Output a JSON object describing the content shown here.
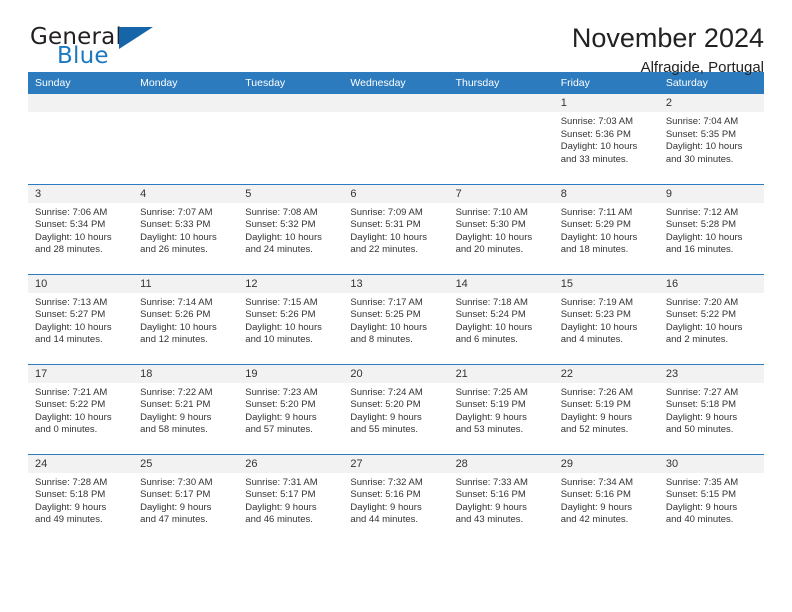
{
  "brand": {
    "name_part1": "General",
    "name_part2": "Blue",
    "flag_icon": "triangle-flag-icon"
  },
  "header": {
    "title": "November 2024",
    "subtitle": "Alfragide, Portugal"
  },
  "colors": {
    "header_blue": "#2c7bbf",
    "brand_blue": "#1c79c0",
    "daynum_bg": "#f2f2f2"
  },
  "weekdays": [
    "Sunday",
    "Monday",
    "Tuesday",
    "Wednesday",
    "Thursday",
    "Friday",
    "Saturday"
  ],
  "weeks": [
    [
      {
        "empty": true
      },
      {
        "empty": true
      },
      {
        "empty": true
      },
      {
        "empty": true
      },
      {
        "empty": true
      },
      {
        "day": "1",
        "sunrise": "Sunrise: 7:03 AM",
        "sunset": "Sunset: 5:36 PM",
        "daylight1": "Daylight: 10 hours",
        "daylight2": "and 33 minutes."
      },
      {
        "day": "2",
        "sunrise": "Sunrise: 7:04 AM",
        "sunset": "Sunset: 5:35 PM",
        "daylight1": "Daylight: 10 hours",
        "daylight2": "and 30 minutes."
      }
    ],
    [
      {
        "day": "3",
        "sunrise": "Sunrise: 7:06 AM",
        "sunset": "Sunset: 5:34 PM",
        "daylight1": "Daylight: 10 hours",
        "daylight2": "and 28 minutes."
      },
      {
        "day": "4",
        "sunrise": "Sunrise: 7:07 AM",
        "sunset": "Sunset: 5:33 PM",
        "daylight1": "Daylight: 10 hours",
        "daylight2": "and 26 minutes."
      },
      {
        "day": "5",
        "sunrise": "Sunrise: 7:08 AM",
        "sunset": "Sunset: 5:32 PM",
        "daylight1": "Daylight: 10 hours",
        "daylight2": "and 24 minutes."
      },
      {
        "day": "6",
        "sunrise": "Sunrise: 7:09 AM",
        "sunset": "Sunset: 5:31 PM",
        "daylight1": "Daylight: 10 hours",
        "daylight2": "and 22 minutes."
      },
      {
        "day": "7",
        "sunrise": "Sunrise: 7:10 AM",
        "sunset": "Sunset: 5:30 PM",
        "daylight1": "Daylight: 10 hours",
        "daylight2": "and 20 minutes."
      },
      {
        "day": "8",
        "sunrise": "Sunrise: 7:11 AM",
        "sunset": "Sunset: 5:29 PM",
        "daylight1": "Daylight: 10 hours",
        "daylight2": "and 18 minutes."
      },
      {
        "day": "9",
        "sunrise": "Sunrise: 7:12 AM",
        "sunset": "Sunset: 5:28 PM",
        "daylight1": "Daylight: 10 hours",
        "daylight2": "and 16 minutes."
      }
    ],
    [
      {
        "day": "10",
        "sunrise": "Sunrise: 7:13 AM",
        "sunset": "Sunset: 5:27 PM",
        "daylight1": "Daylight: 10 hours",
        "daylight2": "and 14 minutes."
      },
      {
        "day": "11",
        "sunrise": "Sunrise: 7:14 AM",
        "sunset": "Sunset: 5:26 PM",
        "daylight1": "Daylight: 10 hours",
        "daylight2": "and 12 minutes."
      },
      {
        "day": "12",
        "sunrise": "Sunrise: 7:15 AM",
        "sunset": "Sunset: 5:26 PM",
        "daylight1": "Daylight: 10 hours",
        "daylight2": "and 10 minutes."
      },
      {
        "day": "13",
        "sunrise": "Sunrise: 7:17 AM",
        "sunset": "Sunset: 5:25 PM",
        "daylight1": "Daylight: 10 hours",
        "daylight2": "and 8 minutes."
      },
      {
        "day": "14",
        "sunrise": "Sunrise: 7:18 AM",
        "sunset": "Sunset: 5:24 PM",
        "daylight1": "Daylight: 10 hours",
        "daylight2": "and 6 minutes."
      },
      {
        "day": "15",
        "sunrise": "Sunrise: 7:19 AM",
        "sunset": "Sunset: 5:23 PM",
        "daylight1": "Daylight: 10 hours",
        "daylight2": "and 4 minutes."
      },
      {
        "day": "16",
        "sunrise": "Sunrise: 7:20 AM",
        "sunset": "Sunset: 5:22 PM",
        "daylight1": "Daylight: 10 hours",
        "daylight2": "and 2 minutes."
      }
    ],
    [
      {
        "day": "17",
        "sunrise": "Sunrise: 7:21 AM",
        "sunset": "Sunset: 5:22 PM",
        "daylight1": "Daylight: 10 hours",
        "daylight2": "and 0 minutes."
      },
      {
        "day": "18",
        "sunrise": "Sunrise: 7:22 AM",
        "sunset": "Sunset: 5:21 PM",
        "daylight1": "Daylight: 9 hours",
        "daylight2": "and 58 minutes."
      },
      {
        "day": "19",
        "sunrise": "Sunrise: 7:23 AM",
        "sunset": "Sunset: 5:20 PM",
        "daylight1": "Daylight: 9 hours",
        "daylight2": "and 57 minutes."
      },
      {
        "day": "20",
        "sunrise": "Sunrise: 7:24 AM",
        "sunset": "Sunset: 5:20 PM",
        "daylight1": "Daylight: 9 hours",
        "daylight2": "and 55 minutes."
      },
      {
        "day": "21",
        "sunrise": "Sunrise: 7:25 AM",
        "sunset": "Sunset: 5:19 PM",
        "daylight1": "Daylight: 9 hours",
        "daylight2": "and 53 minutes."
      },
      {
        "day": "22",
        "sunrise": "Sunrise: 7:26 AM",
        "sunset": "Sunset: 5:19 PM",
        "daylight1": "Daylight: 9 hours",
        "daylight2": "and 52 minutes."
      },
      {
        "day": "23",
        "sunrise": "Sunrise: 7:27 AM",
        "sunset": "Sunset: 5:18 PM",
        "daylight1": "Daylight: 9 hours",
        "daylight2": "and 50 minutes."
      }
    ],
    [
      {
        "day": "24",
        "sunrise": "Sunrise: 7:28 AM",
        "sunset": "Sunset: 5:18 PM",
        "daylight1": "Daylight: 9 hours",
        "daylight2": "and 49 minutes."
      },
      {
        "day": "25",
        "sunrise": "Sunrise: 7:30 AM",
        "sunset": "Sunset: 5:17 PM",
        "daylight1": "Daylight: 9 hours",
        "daylight2": "and 47 minutes."
      },
      {
        "day": "26",
        "sunrise": "Sunrise: 7:31 AM",
        "sunset": "Sunset: 5:17 PM",
        "daylight1": "Daylight: 9 hours",
        "daylight2": "and 46 minutes."
      },
      {
        "day": "27",
        "sunrise": "Sunrise: 7:32 AM",
        "sunset": "Sunset: 5:16 PM",
        "daylight1": "Daylight: 9 hours",
        "daylight2": "and 44 minutes."
      },
      {
        "day": "28",
        "sunrise": "Sunrise: 7:33 AM",
        "sunset": "Sunset: 5:16 PM",
        "daylight1": "Daylight: 9 hours",
        "daylight2": "and 43 minutes."
      },
      {
        "day": "29",
        "sunrise": "Sunrise: 7:34 AM",
        "sunset": "Sunset: 5:16 PM",
        "daylight1": "Daylight: 9 hours",
        "daylight2": "and 42 minutes."
      },
      {
        "day": "30",
        "sunrise": "Sunrise: 7:35 AM",
        "sunset": "Sunset: 5:15 PM",
        "daylight1": "Daylight: 9 hours",
        "daylight2": "and 40 minutes."
      }
    ]
  ]
}
